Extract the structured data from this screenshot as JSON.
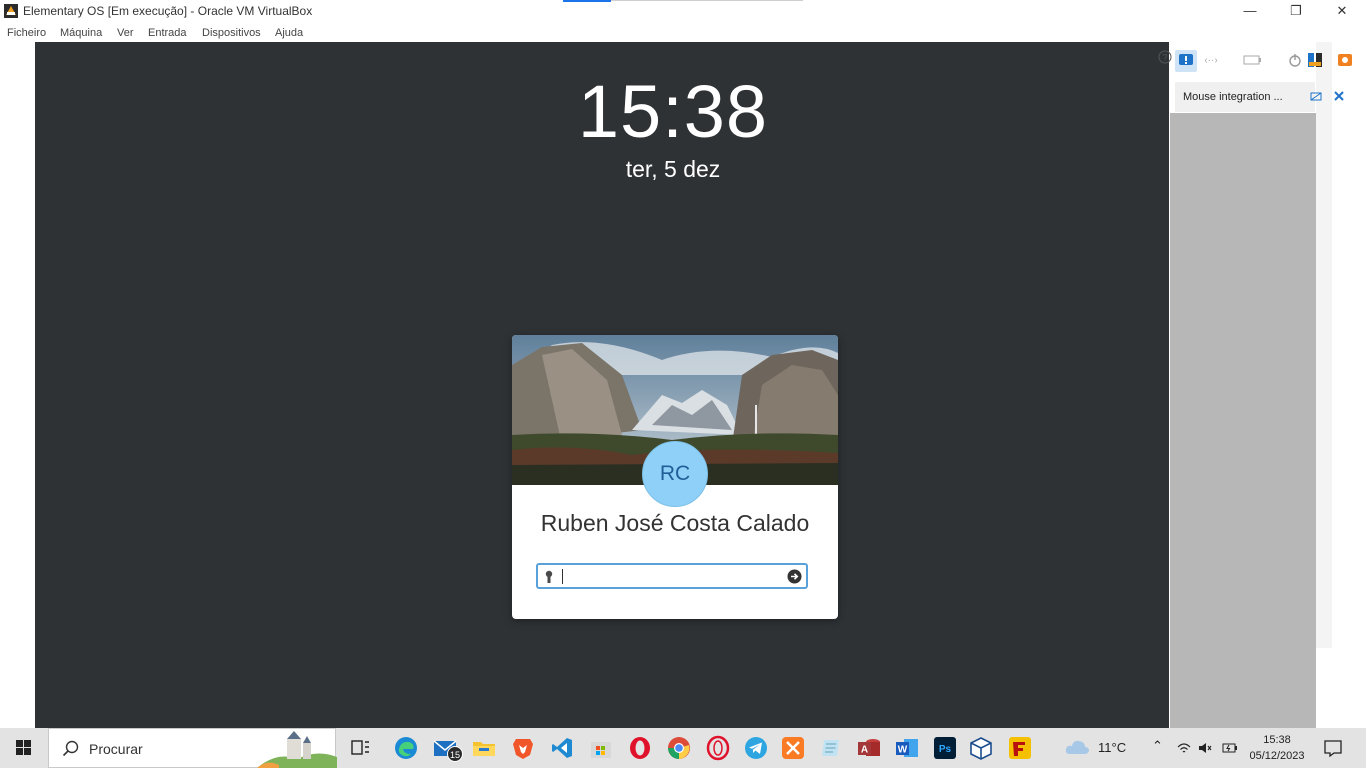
{
  "window": {
    "title": "Elementary OS [Em execução] - Oracle VM VirtualBox",
    "minimize": "—",
    "maximize": "❐",
    "close": "✕"
  },
  "menu": [
    "Ficheiro",
    "Máquina",
    "Ver",
    "Entrada",
    "Dispositivos",
    "Ajuda"
  ],
  "lockscreen": {
    "time": "15:38",
    "date": "ter,  5 dez",
    "avatar_initials": "RC",
    "user_name": "Ruben José Costa Calado",
    "password_value": ""
  },
  "vbox_panel": {
    "mouse_integration_label": "Mouse integration ..."
  },
  "taskbar": {
    "search_placeholder": "Procurar",
    "mail_badge": "15",
    "apps": [
      "task-view",
      "edge",
      "mail",
      "file-explorer",
      "brave",
      "vscode",
      "microsoft-store",
      "opera",
      "chrome",
      "opera-gx",
      "telegram",
      "xampp",
      "notepad",
      "access",
      "word",
      "photoshop",
      "virtualbox",
      "filezilla"
    ],
    "weather": "11°C",
    "clock_time": "15:38",
    "clock_date": "05/12/2023"
  },
  "colors": {
    "vm_background": "#2e3235",
    "avatar": "#8ed0f7",
    "focus_ring": "#5aa1d9",
    "taskbar": "#e3e3e3"
  }
}
